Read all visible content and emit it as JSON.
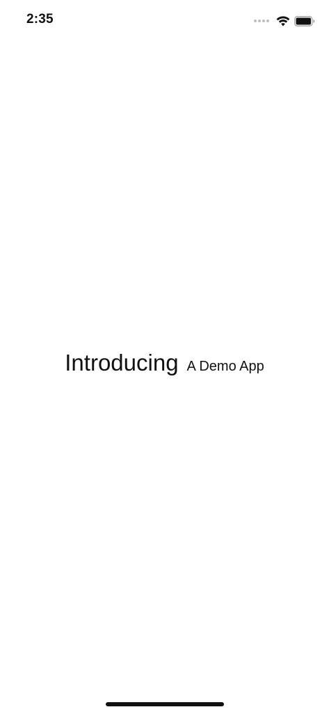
{
  "status_bar": {
    "time": "2:35",
    "icons": [
      "cellular-signal-icon",
      "wifi-icon",
      "battery-icon"
    ]
  },
  "main": {
    "title": "Introducing",
    "subtitle": "A Demo App"
  },
  "home_indicator": {
    "icon": "home-indicator-bar"
  },
  "colors": {
    "background": "#ffffff",
    "text": "#111111",
    "signal_inactive": "#bdbdbd"
  }
}
